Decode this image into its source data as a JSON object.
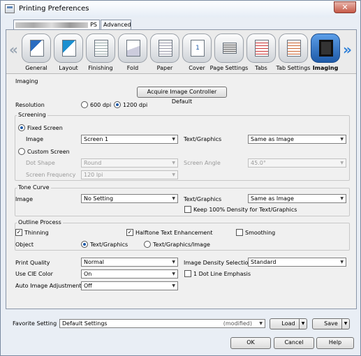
{
  "window": {
    "title": "Printing Preferences",
    "close_glyph": "✕"
  },
  "tabs": {
    "first_suffix": "PS",
    "second": "Advanced"
  },
  "toolbar": {
    "left_arrow": "«",
    "right_arrow": "»",
    "items": [
      {
        "label": "General",
        "icon": "general-icon"
      },
      {
        "label": "Layout",
        "icon": "layout-icon"
      },
      {
        "label": "Finishing",
        "icon": "finishing-icon"
      },
      {
        "label": "Fold",
        "icon": "fold-icon"
      },
      {
        "label": "Paper",
        "icon": "paper-icon"
      },
      {
        "label": "Cover",
        "icon": "cover-icon",
        "glyph": "1"
      },
      {
        "label": "Page Settings",
        "icon": "page-settings-icon"
      },
      {
        "label": "Tabs",
        "icon": "tabs-icon"
      },
      {
        "label": "Tab Settings",
        "icon": "tab-settings-icon"
      },
      {
        "label": "Imaging",
        "icon": "imaging-icon",
        "selected": true
      }
    ]
  },
  "imaging": {
    "section": "Imaging",
    "acquire_button": "Acquire Image Controller Default",
    "resolution_label": "Resolution",
    "resolution_opt1": "600 dpi",
    "resolution_opt2": "1200 dpi",
    "resolution_selected": "1200 dpi"
  },
  "screening": {
    "title": "Screening",
    "fixed_label": "Fixed Screen",
    "image_label": "Image",
    "image_value": "Screen 1",
    "textgfx_label": "Text/Graphics",
    "textgfx_value": "Same as Image",
    "custom_label": "Custom Screen",
    "dot_shape_label": "Dot Shape",
    "dot_shape_value": "Round",
    "screen_angle_label": "Screen Angle",
    "screen_angle_value": "45.0°",
    "screen_freq_label": "Screen Frequency",
    "screen_freq_value": "120 lpi"
  },
  "tone": {
    "title": "Tone Curve",
    "image_label": "Image",
    "image_value": "No Setting",
    "textgfx_label": "Text/Graphics",
    "textgfx_value": "Same as Image",
    "keep_label": "Keep 100% Density for Text/Graphics"
  },
  "outline": {
    "title": "Outline Process",
    "thinning": "Thinning",
    "halftone": "Halftone Text Enhancement",
    "smoothing": "Smoothing",
    "object_label": "Object",
    "obj_opt1": "Text/Graphics",
    "obj_opt2": "Text/Graphics/Image",
    "check_glyph": "✓"
  },
  "quality": {
    "print_quality_label": "Print Quality",
    "print_quality_value": "Normal",
    "density_label": "Image Density Selection",
    "density_value": "Standard",
    "cie_label": "Use CIE Color",
    "cie_value": "On",
    "dot_line_label": "1 Dot Line Emphasis",
    "auto_label": "Auto Image Adjustment",
    "auto_value": "Off"
  },
  "favorite": {
    "label": "Favorite Setting",
    "value": "Default Settings",
    "modified": "(modified)",
    "load": "Load",
    "save": "Save"
  },
  "buttons": {
    "ok": "OK",
    "cancel": "Cancel",
    "help": "Help"
  },
  "colors": {
    "accent": "#1e5aa8",
    "selected_tool": "#2d7fd8",
    "close_red": "#c65a48"
  }
}
